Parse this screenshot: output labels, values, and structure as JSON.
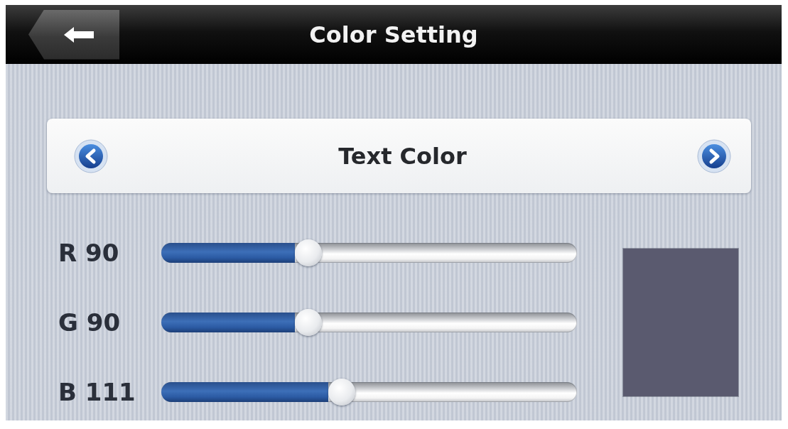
{
  "header": {
    "title": "Color Setting"
  },
  "selector": {
    "label": "Text Color"
  },
  "sliders": [
    {
      "label": "R 90",
      "level": 0.353
    },
    {
      "label": "G 90",
      "level": 0.353
    },
    {
      "label": "B 111",
      "level": 0.435
    }
  ]
}
